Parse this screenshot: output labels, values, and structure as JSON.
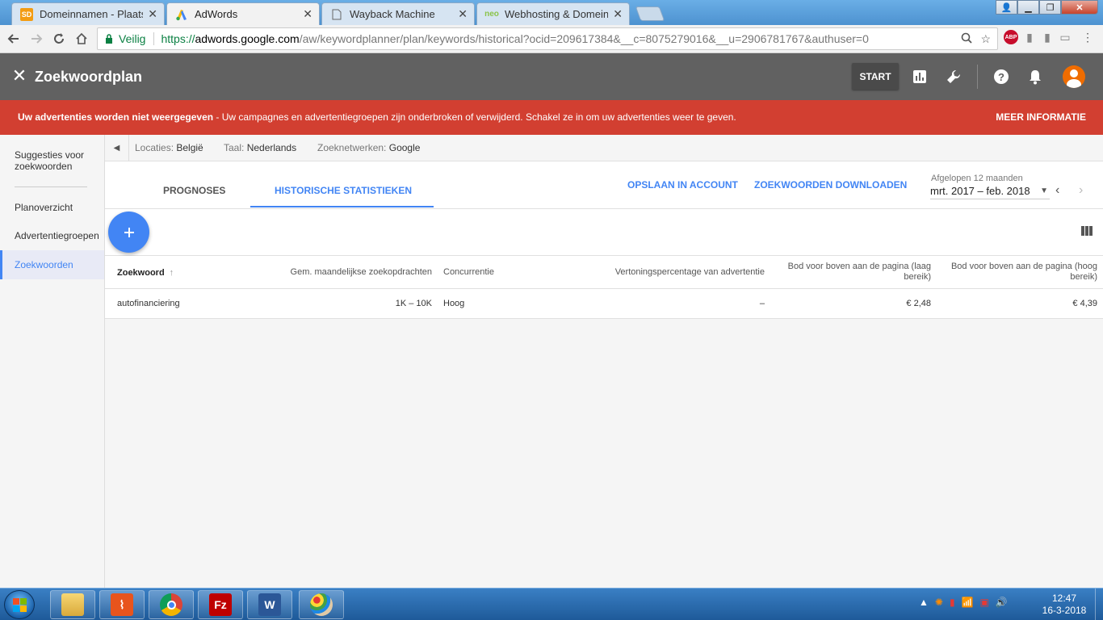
{
  "browser": {
    "tabs": [
      {
        "title": "Domeinnamen - Plaatser",
        "favicon": "SD"
      },
      {
        "title": "AdWords",
        "favicon": "adwords-logo"
      },
      {
        "title": "Wayback Machine",
        "favicon": "page"
      },
      {
        "title": "Webhosting & Domeinn",
        "favicon": "neo"
      }
    ],
    "secure_label": "Veilig",
    "url_scheme": "https://",
    "url_host": "adwords.google.com",
    "url_path": "/aw/keywordplanner/plan/keywords/historical?ocid=209617384&__c=8075279016&__u=2906781767&authuser=0",
    "abp_label": "ABP"
  },
  "app": {
    "title": "Zoekwoordplan",
    "start_label": "START"
  },
  "banner": {
    "bold": "Uw advertenties worden niet weergegeven",
    "text": " - Uw campagnes en advertentiegroepen zijn onderbroken of verwijderd. Schakel ze in om uw advertenties weer te geven.",
    "link": "MEER INFORMATIE"
  },
  "sidebar": {
    "items": [
      {
        "label": "Suggesties voor zoekwoorden"
      },
      {
        "label": "Planoverzicht"
      },
      {
        "label": "Advertentiegroepen"
      },
      {
        "label": "Zoekwoorden"
      }
    ]
  },
  "filters": {
    "location_label": "Locaties:",
    "location_value": "België",
    "language_label": "Taal:",
    "language_value": "Nederlands",
    "network_label": "Zoeknetwerken:",
    "network_value": "Google"
  },
  "tabs": {
    "forecasts": "PROGNOSES",
    "historical": "HISTORISCHE STATISTIEKEN",
    "save": "OPSLAAN IN ACCOUNT",
    "download": "ZOEKWOORDEN DOWNLOADEN",
    "date_label": "Afgelopen 12 maanden",
    "date_value": "mrt. 2017 – feb. 2018"
  },
  "table": {
    "headers": {
      "keyword": "Zoekwoord",
      "searches": "Gem. maandelijkse zoekopdrachten",
      "competition": "Concurrentie",
      "impression": "Vertoningspercentage van advertentie",
      "bid_low": "Bod voor boven aan de pagina (laag bereik)",
      "bid_high": "Bod voor boven aan de pagina (hoog bereik)"
    },
    "rows": [
      {
        "keyword": "autofinanciering",
        "searches": "1K – 10K",
        "competition": "Hoog",
        "impression": "–",
        "bid_low": "€ 2,48",
        "bid_high": "€ 4,39"
      }
    ]
  },
  "taskbar": {
    "time": "12:47",
    "date": "16-3-2018"
  }
}
